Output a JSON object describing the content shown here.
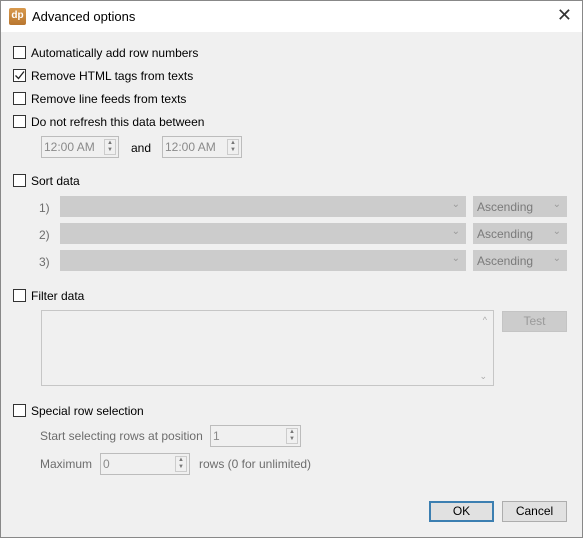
{
  "window": {
    "title": "Advanced options",
    "logo_text": "dp"
  },
  "options": [
    {
      "label": "Automatically add row numbers",
      "checked": false
    },
    {
      "label": "Remove HTML tags from texts",
      "checked": true
    },
    {
      "label": "Remove line feeds from texts",
      "checked": false
    },
    {
      "label": "Do not refresh this data between",
      "checked": false
    }
  ],
  "refresh": {
    "from": "12:00 AM",
    "and_label": "and",
    "to": "12:00 AM"
  },
  "sort": {
    "label": "Sort data",
    "checked": false,
    "rows": [
      {
        "index": "1)",
        "field": "",
        "order": "Ascending"
      },
      {
        "index": "2)",
        "field": "",
        "order": "Ascending"
      },
      {
        "index": "3)",
        "field": "",
        "order": "Ascending"
      }
    ]
  },
  "filter": {
    "label": "Filter data",
    "checked": false,
    "text": "",
    "test_label": "Test"
  },
  "special": {
    "label": "Special row selection",
    "checked": false,
    "start_label": "Start selecting rows at position",
    "start_value": "1",
    "max_label": "Maximum",
    "max_value": "0",
    "rows_hint": "rows (0 for unlimited)"
  },
  "buttons": {
    "ok": "OK",
    "cancel": "Cancel"
  }
}
